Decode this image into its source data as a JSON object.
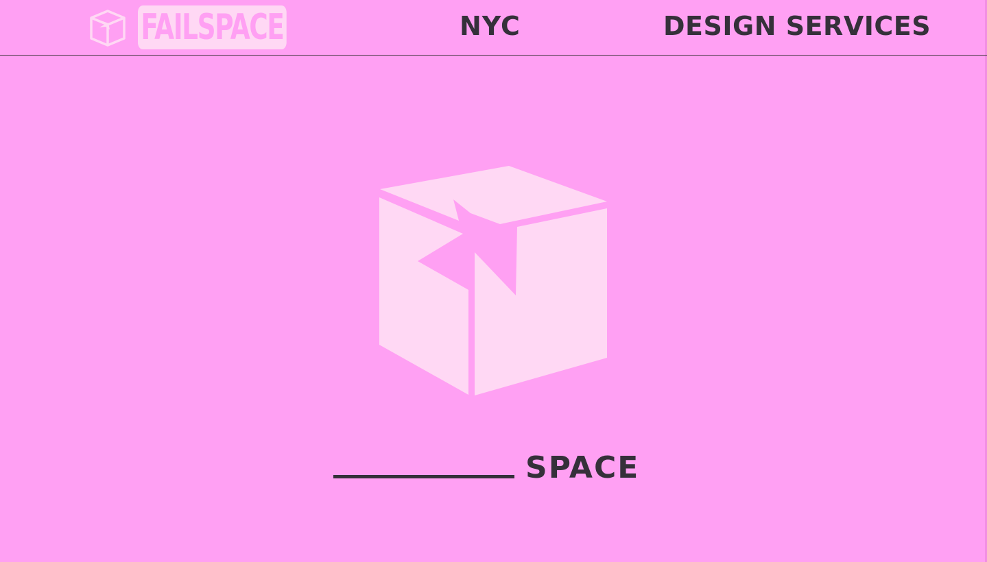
{
  "header": {
    "logo_text": "FAILSPACE",
    "nav": [
      {
        "label": "NYC"
      },
      {
        "label": "DESIGN SERVICES"
      }
    ]
  },
  "hero": {
    "tagline_word": "SPACE",
    "icon": "open-box-icon"
  },
  "colors": {
    "background": "#ffa0f3",
    "light_pink": "#ffd8f4",
    "text_dark": "#35303a"
  }
}
